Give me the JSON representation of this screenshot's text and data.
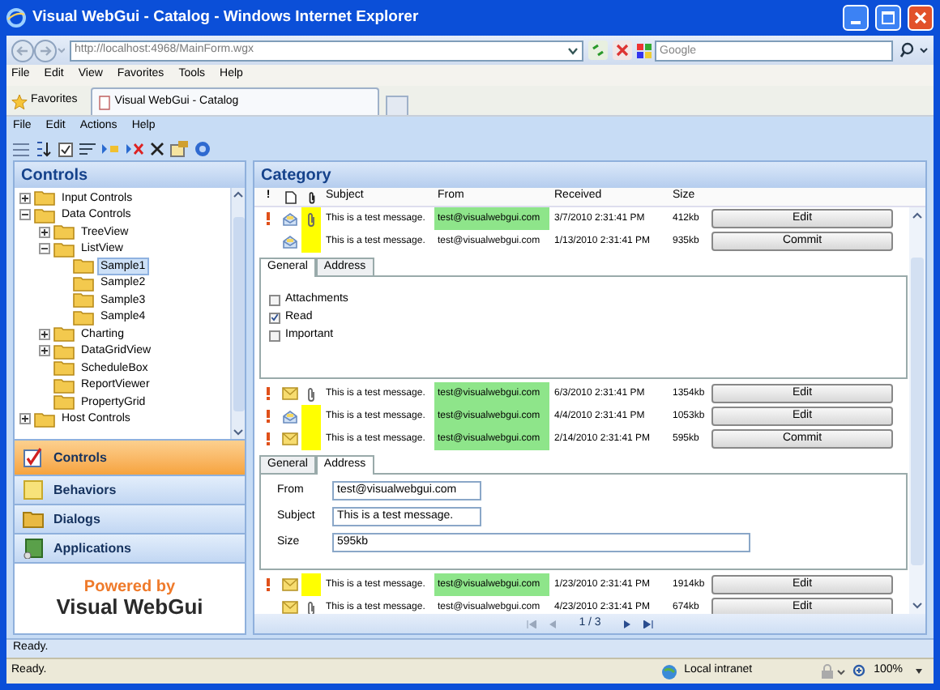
{
  "window": {
    "title": "Visual WebGui - Catalog - Windows Internet Explorer"
  },
  "browser": {
    "address": "http://localhost:4968/MainForm.wgx",
    "search_placeholder": "Google",
    "menu": [
      "File",
      "Edit",
      "View",
      "Favorites",
      "Tools",
      "Help"
    ],
    "favorites": "Favorites",
    "tabs": [
      {
        "label": "Visual WebGui - Catalog",
        "selected": true
      }
    ],
    "status": "Ready.",
    "zone": "Local intranet",
    "zoom": "100%"
  },
  "app": {
    "menu": [
      "File",
      "Edit",
      "Actions",
      "Help"
    ],
    "sidebar": {
      "title": "Controls",
      "tree": [
        {
          "label": "Input Controls",
          "expanded": false,
          "selected": false
        },
        {
          "label": "Data Controls",
          "expanded": true,
          "selected": false,
          "children": [
            {
              "label": "TreeView",
              "expanded": false,
              "selected": false
            },
            {
              "label": "ListView",
              "expanded": true,
              "selected": false,
              "children": [
                {
                  "label": "Sample1",
                  "selected": true
                },
                {
                  "label": "Sample2",
                  "selected": false
                },
                {
                  "label": "Sample3",
                  "selected": false
                },
                {
                  "label": "Sample4",
                  "selected": false
                }
              ]
            },
            {
              "label": "Charting",
              "expanded": false,
              "selected": false
            },
            {
              "label": "DataGridView",
              "expanded": false,
              "selected": false
            },
            {
              "label": "ScheduleBox",
              "selected": false
            },
            {
              "label": "ReportViewer",
              "selected": false
            },
            {
              "label": "PropertyGrid",
              "selected": false
            }
          ]
        },
        {
          "label": "Host Controls",
          "expanded": false,
          "selected": false
        }
      ],
      "nav": [
        {
          "label": "Controls",
          "kind": "controls",
          "selected": true
        },
        {
          "label": "Behaviors",
          "kind": "behaviors",
          "selected": false
        },
        {
          "label": "Dialogs",
          "kind": "dialogs",
          "selected": false
        },
        {
          "label": "Applications",
          "kind": "applications",
          "selected": false
        }
      ],
      "brand": {
        "tagline": "Powered by",
        "name": "Visual WebGui"
      }
    },
    "content": {
      "title": "Category",
      "columns": [
        {
          "kind": "text",
          "label": "!"
        },
        {
          "kind": "document"
        },
        {
          "kind": "clip"
        },
        {
          "kind": "text",
          "label": "Subject"
        },
        {
          "kind": "text",
          "label": "From"
        },
        {
          "kind": "text",
          "label": "Received"
        },
        {
          "kind": "text",
          "label": "Size"
        }
      ],
      "rows": [
        {
          "kind": "message",
          "important": true,
          "read": true,
          "attachment": true,
          "flagged": true,
          "subject": "This is a test message.",
          "from": "test@visualwebgui.com",
          "from_highlight": true,
          "received": "3/7/2010 2:31:41 PM",
          "size": "412kb",
          "action": "Edit"
        },
        {
          "kind": "message",
          "important": false,
          "read": true,
          "attachment": false,
          "flagged": true,
          "subject": "This is a test message.",
          "from": "test@visualwebgui.com",
          "from_highlight": false,
          "received": "1/13/2010 2:31:41 PM",
          "size": "935kb",
          "action": "Commit"
        },
        {
          "kind": "general",
          "tabs": [
            {
              "label": "General",
              "selected": true
            },
            {
              "label": "Address",
              "selected": false
            }
          ],
          "checks": [
            {
              "label": "Attachments",
              "checked": false
            },
            {
              "label": "Read",
              "checked": true
            },
            {
              "label": "Important",
              "checked": false
            }
          ]
        },
        {
          "kind": "message",
          "important": true,
          "read": false,
          "attachment": true,
          "flagged": false,
          "subject": "This is a test message.",
          "from": "test@visualwebgui.com",
          "from_highlight": true,
          "received": "6/3/2010 2:31:41 PM",
          "size": "1354kb",
          "action": "Edit"
        },
        {
          "kind": "message",
          "important": true,
          "read": true,
          "attachment": false,
          "flagged": true,
          "subject": "This is a test message.",
          "from": "test@visualwebgui.com",
          "from_highlight": true,
          "received": "4/4/2010 2:31:41 PM",
          "size": "1053kb",
          "action": "Edit"
        },
        {
          "kind": "message",
          "important": true,
          "read": false,
          "attachment": false,
          "flagged": true,
          "subject": "This is a test message.",
          "from": "test@visualwebgui.com",
          "from_highlight": true,
          "received": "2/14/2010 2:31:41 PM",
          "size": "595kb",
          "action": "Commit"
        },
        {
          "kind": "address",
          "tabs": [
            {
              "label": "General",
              "selected": false
            },
            {
              "label": "Address",
              "selected": true
            }
          ],
          "fields": [
            {
              "label": "From",
              "value": "test@visualwebgui.com",
              "wide": false
            },
            {
              "label": "Subject",
              "value": "This is a test message.",
              "wide": false
            },
            {
              "label": "Size",
              "value": "595kb",
              "wide": true
            }
          ]
        },
        {
          "kind": "message",
          "important": true,
          "read": false,
          "attachment": false,
          "flagged": true,
          "subject": "This is a test message.",
          "from": "test@visualwebgui.com",
          "from_highlight": true,
          "received": "1/23/2010 2:31:41 PM",
          "size": "1914kb",
          "action": "Edit"
        },
        {
          "kind": "message",
          "important": false,
          "read": false,
          "attachment": true,
          "flagged": false,
          "subject": "This is a test message.",
          "from": "test@visualwebgui.com",
          "from_highlight": false,
          "received": "4/23/2010 2:31:41 PM",
          "size": "674kb",
          "action": "Edit"
        }
      ],
      "pager": "1 / 3"
    },
    "status": "Ready."
  }
}
